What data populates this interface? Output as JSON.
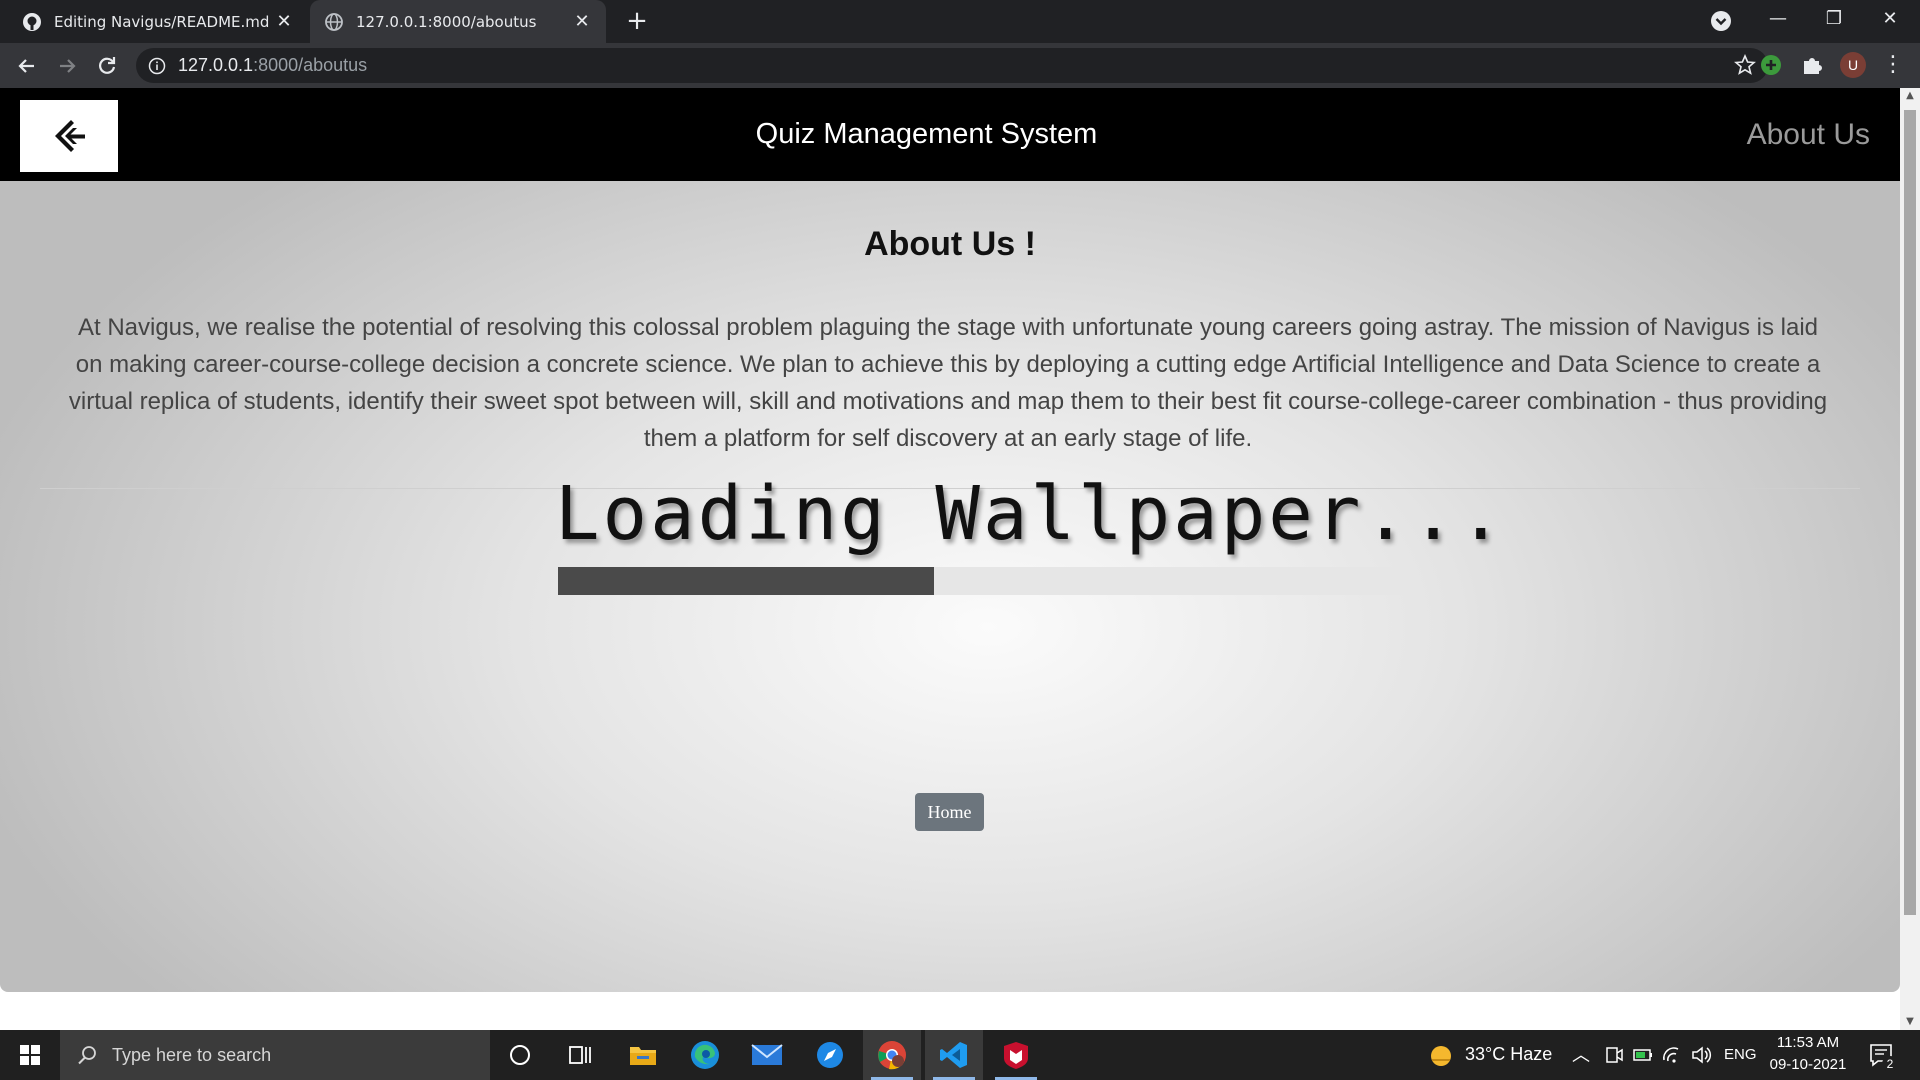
{
  "browser": {
    "tabs": [
      {
        "title": "Editing Navigus/README.md at r",
        "active": false,
        "favicon": "github-icon"
      },
      {
        "title": "127.0.0.1:8000/aboutus",
        "active": true,
        "favicon": "globe-icon"
      }
    ],
    "new_tab_label": "+",
    "url_host": "127.0.0.1",
    "url_rest": ":8000/aboutus",
    "profile_initial": "U",
    "window_controls": {
      "minimize": "—",
      "restore": "❐",
      "close": "✕"
    },
    "tab_close_glyph": "✕",
    "menu_glyph": "⋮"
  },
  "site": {
    "title": "Quiz Management System",
    "nav_about": "About Us",
    "logo_icon": "back-arrow-logo-icon"
  },
  "page": {
    "heading": "About Us !",
    "paragraph": "At Navigus, we realise the potential of resolving this colossal problem plaguing the stage with unfortunate young careers going astray. The mission of Navigus is laid on making career-course-college decision a concrete science. We plan to achieve this by deploying a cutting edge Artificial Intelligence and Data Science to create a virtual replica of students, identify their sweet spot between will, skill and motivations and map them to their best fit course-college-career combination - thus providing them a platform for self discovery at an early stage of life.",
    "loading_text": "Loading Wallpaper...",
    "loading_progress": 0.445,
    "home_button": "Home"
  },
  "taskbar": {
    "search_placeholder": "Type here to search",
    "weather": "33°C  Haze",
    "language": "ENG",
    "time": "11:53 AM",
    "date": "09-10-2021",
    "notification_count": "2",
    "apps": [
      "cortana-icon",
      "task-view-icon",
      "file-explorer-icon",
      "edge-icon",
      "mail-icon",
      "safari-like-icon",
      "chrome-icon",
      "vscode-icon",
      "mcafee-icon"
    ]
  },
  "colors": {
    "tab_strip": "#202124",
    "toolbar": "#35363a",
    "site_nav": "#000000",
    "home_button": "#6c757d",
    "progress_fill": "#4a4a4a",
    "taskbar": "#202020"
  }
}
